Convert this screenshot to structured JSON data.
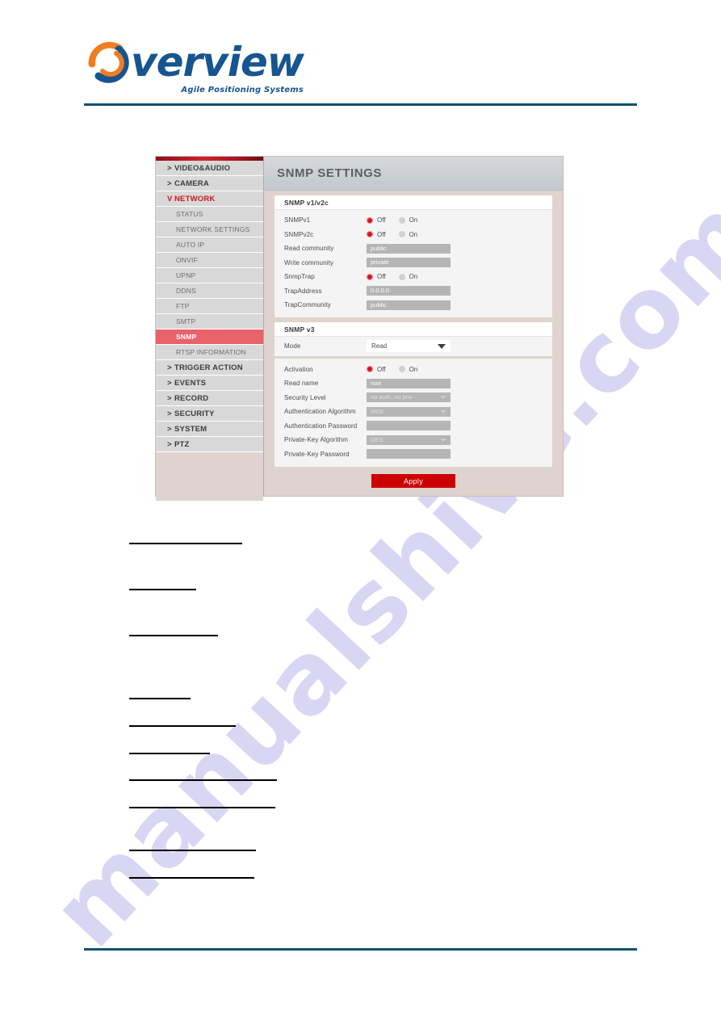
{
  "document": {
    "brand": {
      "word": "verview",
      "tagline": "Agile Positioning Systems",
      "logo_icon": "overview-swoosh-logo",
      "blue": "#16558f",
      "orange": "#ef7d22",
      "rule_color": "#0d5273"
    }
  },
  "screenshot": {
    "sidebar": {
      "items": [
        {
          "label": "VIDEO&AUDIO",
          "caret": ">",
          "type": "group"
        },
        {
          "label": "CAMERA",
          "caret": ">",
          "type": "group"
        },
        {
          "label": "NETWORK",
          "caret": "V",
          "type": "group",
          "state": "expanded"
        },
        {
          "label": "STATUS",
          "type": "sub"
        },
        {
          "label": "NETWORK SETTINGS",
          "type": "sub"
        },
        {
          "label": "AUTO IP",
          "type": "sub"
        },
        {
          "label": "ONVIF",
          "type": "sub"
        },
        {
          "label": "UPNP",
          "type": "sub"
        },
        {
          "label": "DDNS",
          "type": "sub"
        },
        {
          "label": "FTP",
          "type": "sub"
        },
        {
          "label": "SMTP",
          "type": "sub"
        },
        {
          "label": "SNMP",
          "type": "sub",
          "state": "selected"
        },
        {
          "label": "RTSP INFORMATION",
          "type": "sub"
        },
        {
          "label": "TRIGGER ACTION",
          "caret": ">",
          "type": "group"
        },
        {
          "label": "EVENTS",
          "caret": ">",
          "type": "group"
        },
        {
          "label": "RECORD",
          "caret": ">",
          "type": "group"
        },
        {
          "label": "SECURITY",
          "caret": ">",
          "type": "group"
        },
        {
          "label": "SYSTEM",
          "caret": ">",
          "type": "group"
        },
        {
          "label": "PTZ",
          "caret": ">",
          "type": "group"
        }
      ]
    },
    "page_title": "SNMP SETTINGS",
    "v1v2c": {
      "title": "SNMP v1/v2c",
      "snmpv1": {
        "label": "SNMPv1",
        "off": "Off",
        "on": "On",
        "value": "Off"
      },
      "snmpv2c": {
        "label": "SNMPv2c",
        "off": "Off",
        "on": "On",
        "value": "Off"
      },
      "read_community": {
        "label": "Read community",
        "value": "public"
      },
      "write_community": {
        "label": "Write community",
        "value": "private"
      },
      "snmptrap": {
        "label": "SnmpTrap",
        "off": "Off",
        "on": "On",
        "value": "Off"
      },
      "trap_address": {
        "label": "TrapAddress",
        "value": "0.0.0.0"
      },
      "trap_community": {
        "label": "TrapCommunity",
        "value": "public"
      }
    },
    "v3": {
      "title": "SNMP v3",
      "mode": {
        "label": "Mode",
        "value": "Read"
      },
      "activation": {
        "label": "Activation",
        "off": "Off",
        "on": "On",
        "value": "Off"
      },
      "read_name": {
        "label": "Read name",
        "value": "root"
      },
      "security_level": {
        "label": "Security Level",
        "value": "no auth, no priv"
      },
      "auth_algorithm": {
        "label": "Authentication Algorithm",
        "value": "MD5"
      },
      "auth_password": {
        "label": "Authentication Password",
        "value": ""
      },
      "privkey_algorithm": {
        "label": "Private-Key Algorithm",
        "value": "DES"
      },
      "privkey_password": {
        "label": "Private-Key Password",
        "value": ""
      }
    },
    "apply_button": "Apply",
    "accent_red": "#cc0000",
    "selected_red": "#e8626a"
  },
  "watermark": {
    "text": "manualshive.com"
  }
}
